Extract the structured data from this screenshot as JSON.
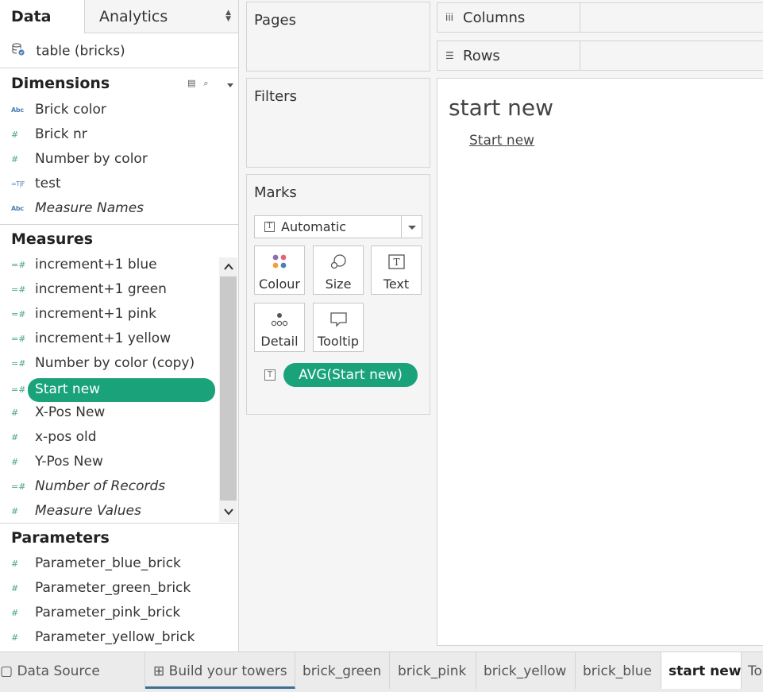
{
  "data_pane": {
    "tab_data": "Data",
    "tab_analytics": "Analytics",
    "datasource": "table (bricks)",
    "dimensions_title": "Dimensions",
    "dimensions": [
      {
        "icon": "Abc",
        "label": "Brick color",
        "italic": false
      },
      {
        "icon": "#",
        "label": "Brick nr",
        "italic": false
      },
      {
        "icon": "#",
        "label": "Number by color",
        "italic": false
      },
      {
        "icon": "=T|F",
        "label": "test",
        "italic": false
      },
      {
        "icon": "Abc",
        "label": "Measure Names",
        "italic": true
      }
    ],
    "measures_title": "Measures",
    "measures": [
      {
        "icon": "=#",
        "label": "increment+1 blue",
        "italic": false
      },
      {
        "icon": "=#",
        "label": "increment+1 green",
        "italic": false
      },
      {
        "icon": "=#",
        "label": "increment+1 pink",
        "italic": false
      },
      {
        "icon": "=#",
        "label": "increment+1 yellow",
        "italic": false
      },
      {
        "icon": "=#",
        "label": "Number by color (copy)",
        "italic": false
      },
      {
        "icon": "=#",
        "label": "Start new",
        "italic": false,
        "selected": true
      },
      {
        "icon": "#",
        "label": "X-Pos New",
        "italic": false
      },
      {
        "icon": "#",
        "label": "x-pos old",
        "italic": false
      },
      {
        "icon": "#",
        "label": "Y-Pos New",
        "italic": false
      },
      {
        "icon": "=#",
        "label": "Number of Records",
        "italic": true
      },
      {
        "icon": "#",
        "label": "Measure Values",
        "italic": true
      }
    ],
    "parameters_title": "Parameters",
    "parameters": [
      {
        "icon": "#",
        "label": "Parameter_blue_brick"
      },
      {
        "icon": "#",
        "label": "Parameter_green_brick"
      },
      {
        "icon": "#",
        "label": "Parameter_pink_brick"
      },
      {
        "icon": "#",
        "label": "Parameter_yellow_brick"
      }
    ]
  },
  "cards": {
    "pages": "Pages",
    "filters": "Filters",
    "marks": "Marks",
    "mark_type": "Automatic",
    "buttons": {
      "colour": "Colour",
      "size": "Size",
      "text": "Text",
      "detail": "Detail",
      "tooltip": "Tooltip"
    },
    "pill_icon": "T",
    "pill": "AVG(Start new)"
  },
  "shelves": {
    "columns": "Columns",
    "rows": "Rows"
  },
  "view": {
    "title": "start new",
    "link": "Start new"
  },
  "bottom_tabs": [
    {
      "label": "Data Source",
      "icon": "▢"
    },
    {
      "label": "Build your towers",
      "icon": "⊞"
    },
    {
      "label": "brick_green"
    },
    {
      "label": "brick_pink"
    },
    {
      "label": "brick_yellow"
    },
    {
      "label": "brick_blue"
    },
    {
      "label": "start new",
      "active": true
    },
    {
      "label": "To"
    }
  ],
  "colors": {
    "accent_green": "#1aa37a",
    "field_icon_green": "#4aa587",
    "field_icon_blue": "#4a7fb5",
    "build_tab_underline": "#3f6f92"
  }
}
